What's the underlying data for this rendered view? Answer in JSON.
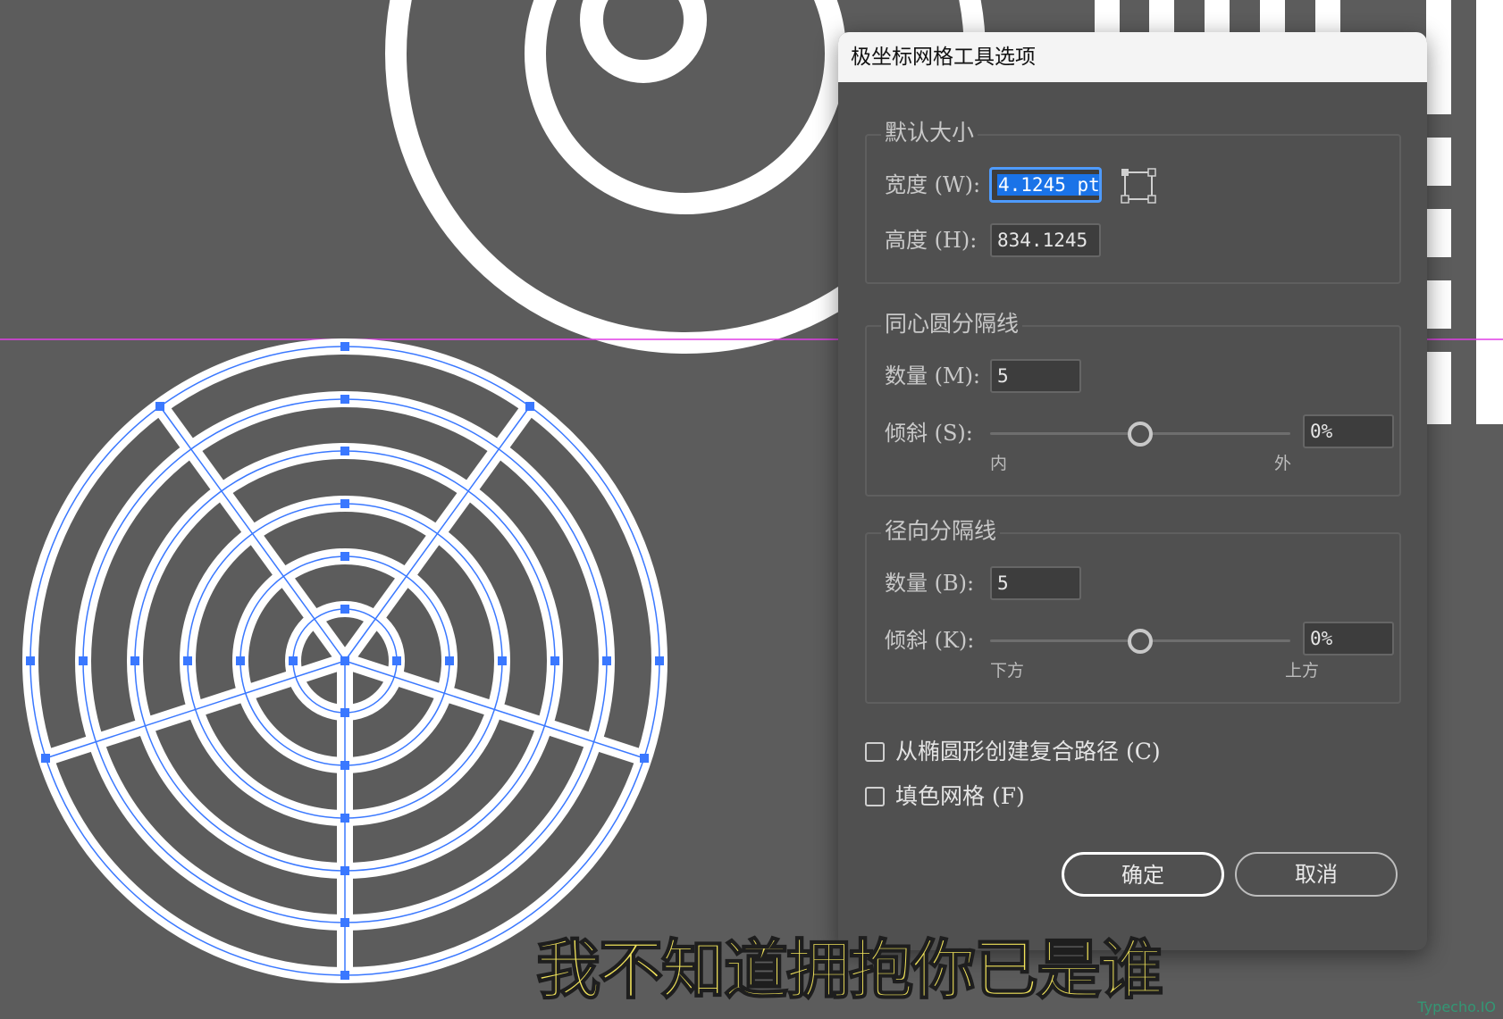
{
  "dialog": {
    "title": "极坐标网格工具选项",
    "default_size": {
      "legend": "默认大小",
      "width_label": "宽度 (W):",
      "width_value": "4.1245 pt",
      "height_label": "高度 (H):",
      "height_value": "834.1245"
    },
    "concentric": {
      "legend": "同心圆分隔线",
      "count_label": "数量 (M):",
      "count_value": "5",
      "skew_label": "倾斜 (S):",
      "skew_value": "0%",
      "skew_position": 0.5,
      "min_label": "内",
      "max_label": "外"
    },
    "radial": {
      "legend": "径向分隔线",
      "count_label": "数量 (B):",
      "count_value": "5",
      "skew_label": "倾斜 (K):",
      "skew_value": "0%",
      "skew_position": 0.5,
      "min_label": "下方",
      "max_label": "上方"
    },
    "checkboxes": [
      {
        "label": "从椭圆形创建复合路径 (C)",
        "checked": false
      },
      {
        "label": "填色网格 (F)",
        "checked": false
      }
    ],
    "ok_label": "确定",
    "cancel_label": "取消",
    "reference_point_icon": "reference-point-icon"
  },
  "subtitle": "我不知道拥抱你已是谁",
  "watermark": "Typecho.IO",
  "colors": {
    "canvas": "#5c5c5c",
    "dialog": "#505050",
    "selection": "#3a78ff",
    "guide": "#e03fe6",
    "highlight": "#1a73e8",
    "subtitle": "#f1e35a"
  }
}
